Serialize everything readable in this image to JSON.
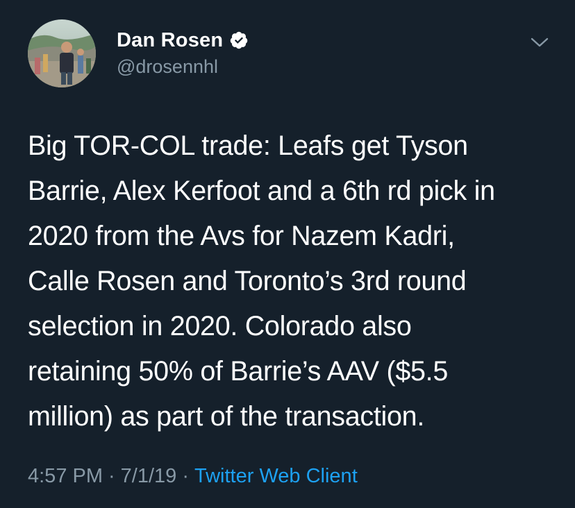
{
  "user": {
    "display_name": "Dan Rosen",
    "handle": "@drosennhl",
    "verified": true
  },
  "tweet": {
    "lines": [
      "Big TOR-COL trade: Leafs get Tyson",
      "Barrie, Alex Kerfoot and a 6th rd pick in",
      "2020 from the Avs for Nazem Kadri,",
      "Calle Rosen and Toronto’s 3rd round",
      "selection in 2020. Colorado also",
      "retaining 50% of Barrie’s AAV ($5.5",
      "million) as part of the transaction."
    ]
  },
  "meta": {
    "time": "4:57 PM",
    "separator": "·",
    "date": "7/1/19",
    "client": "Twitter Web Client"
  },
  "icons": {
    "verified": "verified-badge-icon",
    "menu": "chevron-down-icon"
  },
  "colors": {
    "background": "#15202b",
    "text": "#ffffff",
    "secondary": "#8899a6",
    "link": "#1da1f2"
  }
}
